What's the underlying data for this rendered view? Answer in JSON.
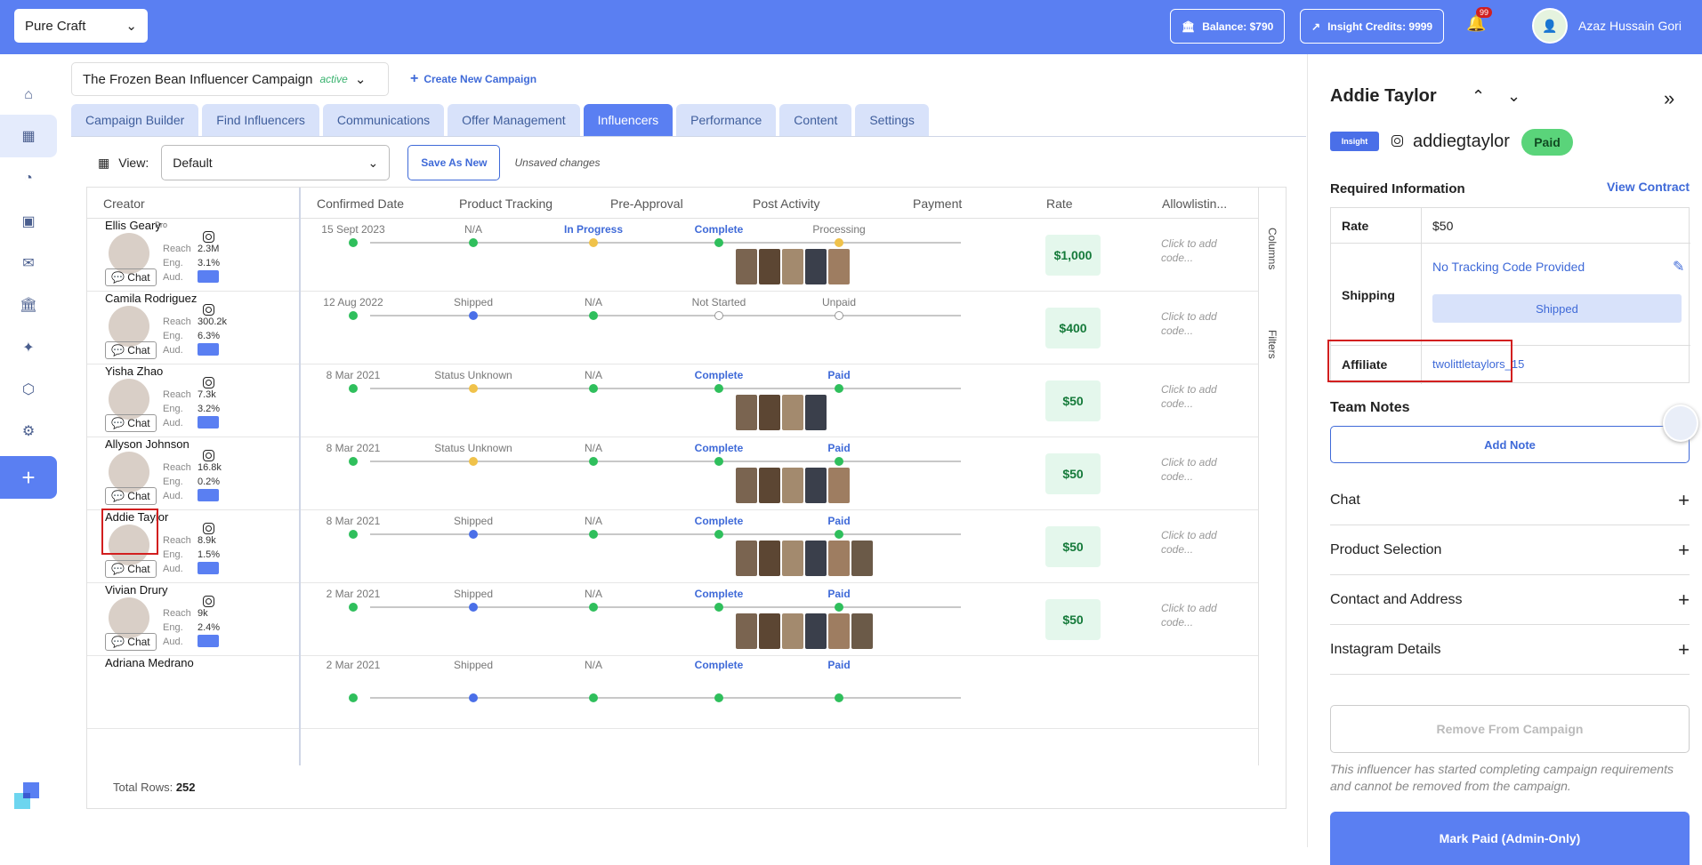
{
  "brand": {
    "name": "Pure Craft"
  },
  "header": {
    "balance": "Balance: $790",
    "credits": "Insight Credits: 9999",
    "notif_count": "99",
    "user_name": "Azaz Hussain Gori"
  },
  "campaign": {
    "name": "The Frozen Bean Influencer Campaign",
    "status": "active",
    "create_new": "Create New Campaign"
  },
  "tabs": [
    "Campaign Builder",
    "Find Influencers",
    "Communications",
    "Offer Management",
    "Influencers",
    "Performance",
    "Content",
    "Settings"
  ],
  "view": {
    "label": "View:",
    "value": "Default",
    "save_new": "Save As New",
    "unsaved": "Unsaved changes"
  },
  "columns": [
    "Creator",
    "Confirmed Date",
    "Product Tracking",
    "Pre-Approval",
    "Post Activity",
    "Payment",
    "Rate",
    "Allowlistin..."
  ],
  "side_tabs": {
    "columns": "Columns",
    "filters": "Filters"
  },
  "rows": [
    {
      "name": "Ellis Geary",
      "pro": "Pro",
      "reach": "2.3M",
      "eng": "3.1%",
      "date": "15 Sept 2023",
      "tracking": "N/A",
      "pre": "In Progress",
      "post": "Complete",
      "payment": "Processing",
      "rate": "$1,000",
      "allow": "Click to add code..."
    },
    {
      "name": "Camila Rodriguez",
      "reach": "300.2k",
      "eng": "6.3%",
      "date": "12 Aug 2022",
      "tracking": "Shipped",
      "pre": "N/A",
      "post": "Not Started",
      "payment": "Unpaid",
      "rate": "$400",
      "allow": "Click to add code..."
    },
    {
      "name": "Yisha Zhao",
      "reach": "7.3k",
      "eng": "3.2%",
      "date": "8 Mar 2021",
      "tracking": "Status Unknown",
      "pre": "N/A",
      "post": "Complete",
      "payment": "Paid",
      "rate": "$50",
      "allow": "Click to add code..."
    },
    {
      "name": "Allyson Johnson",
      "reach": "16.8k",
      "eng": "0.2%",
      "date": "8 Mar 2021",
      "tracking": "Status Unknown",
      "pre": "N/A",
      "post": "Complete",
      "payment": "Paid",
      "rate": "$50",
      "allow": "Click to add code..."
    },
    {
      "name": "Addie Taylor",
      "reach": "8.9k",
      "eng": "1.5%",
      "date": "8 Mar 2021",
      "tracking": "Shipped",
      "pre": "N/A",
      "post": "Complete",
      "payment": "Paid",
      "rate": "$50",
      "allow": "Click to add code..."
    },
    {
      "name": "Vivian Drury",
      "reach": "9k",
      "eng": "2.4%",
      "date": "2 Mar 2021",
      "tracking": "Shipped",
      "pre": "N/A",
      "post": "Complete",
      "payment": "Paid",
      "rate": "$50",
      "allow": "Click to add code..."
    },
    {
      "name": "Adriana Medrano",
      "date": "2 Mar 2021",
      "tracking": "Shipped",
      "pre": "N/A",
      "post": "Complete",
      "payment": "Paid"
    }
  ],
  "labels": {
    "reach": "Reach",
    "eng": "Eng.",
    "aud": "Aud.",
    "chat": "Chat"
  },
  "total": {
    "label": "Total Rows:",
    "value": "252"
  },
  "panel": {
    "name": "Addie Taylor",
    "insight": "Insight",
    "handle": "addiegtaylor",
    "status": "Paid",
    "required": "Required Information",
    "view_contract": "View Contract",
    "rate_label": "Rate",
    "rate_value": "$50",
    "shipping_label": "Shipping",
    "tracking": "No Tracking Code Provided",
    "shipped": "Shipped",
    "affiliate_label": "Affiliate",
    "affiliate_value": "twolittletaylors_15",
    "team_notes": "Team Notes",
    "add_note": "Add Note",
    "sections": [
      "Chat",
      "Product Selection",
      "Contact and Address",
      "Instagram Details"
    ],
    "remove": "Remove From Campaign",
    "note": "This influencer has started completing campaign requirements and cannot be removed from the campaign.",
    "mark_paid": "Mark Paid (Admin-Only)"
  }
}
